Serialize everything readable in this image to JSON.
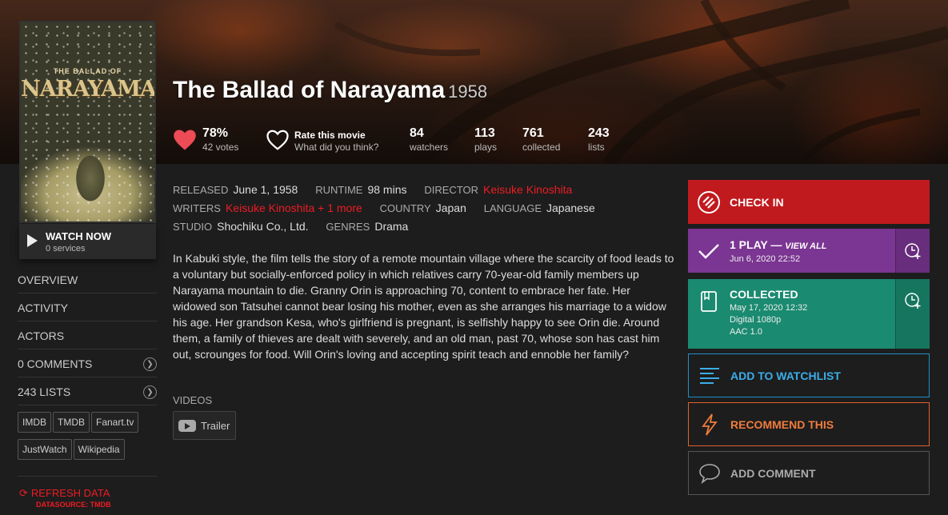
{
  "movie": {
    "title": "The Ballad of Narayama",
    "year": "1958",
    "poster_small": "THE BALLAD OF",
    "poster_big": "NARAYAMA"
  },
  "watch_now": {
    "label": "WATCH NOW",
    "sub": "0 services"
  },
  "nav": [
    {
      "label": "OVERVIEW"
    },
    {
      "label": "ACTIVITY"
    },
    {
      "label": "ACTORS"
    },
    {
      "label": "0 COMMENTS"
    },
    {
      "label": "243 LISTS"
    }
  ],
  "external_links": [
    "IMDB",
    "TMDB",
    "Fanart.tv",
    "JustWatch",
    "Wikipedia"
  ],
  "refresh": {
    "label": "REFRESH DATA",
    "source": "DATASOURCE: TMDB"
  },
  "stats": {
    "rating": {
      "value": "78%",
      "label": "42 votes"
    },
    "rate": {
      "value": "Rate this movie",
      "label": "What did you think?"
    },
    "watchers": {
      "value": "84",
      "label": "watchers"
    },
    "plays": {
      "value": "113",
      "label": "plays"
    },
    "collected": {
      "value": "761",
      "label": "collected"
    },
    "lists": {
      "value": "243",
      "label": "lists"
    }
  },
  "meta": {
    "released_k": "RELEASED",
    "released": "June 1, 1958",
    "runtime_k": "RUNTIME",
    "runtime": "98 mins",
    "director_k": "DIRECTOR",
    "director": "Keisuke Kinoshita",
    "writers_k": "WRITERS",
    "writers": "Keisuke Kinoshita + 1 more",
    "country_k": "COUNTRY",
    "country": "Japan",
    "language_k": "LANGUAGE",
    "language": "Japanese",
    "studio_k": "STUDIO",
    "studio": "Shochiku Co., Ltd.",
    "genres_k": "GENRES",
    "genres": "Drama"
  },
  "overview": "In Kabuki style, the film tells the story of a remote mountain village where the scarcity of food leads to a voluntary but socially-enforced policy in which relatives carry 70-year-old family members up Narayama mountain to die. Granny Orin is approaching 70, content to embrace her fate. Her widowed son Tatsuhei cannot bear losing his mother, even as she arranges his marriage to a widow his age. Her grandson Kesa, who's girlfriend is pregnant, is selfishly happy to see Orin die. Around them, a family of thieves are dealt with severely, and an old man, past 70, whose son has cast him out, scrounges for food. Will Orin's loving and accepting spirit teach and ennoble her family?",
  "videos": {
    "heading": "VIDEOS",
    "trailer": "Trailer"
  },
  "actions": {
    "checkin": "CHECK IN",
    "plays_title": "1 PLAY —",
    "plays_view_all": "VIEW ALL",
    "plays_date": "Jun 6, 2020 22:52",
    "collected_title": "COLLECTED",
    "collected_date": "May 17, 2020 12:32",
    "collected_format": "Digital 1080p",
    "collected_audio": "AAC 1.0",
    "watchlist": "ADD TO WATCHLIST",
    "recommend": "RECOMMEND THIS",
    "comment": "ADD COMMENT"
  },
  "colors": {
    "accent": "#ed1c24",
    "checkin": "#c11a1e",
    "plays": "#7b3592",
    "collected": "#1a8a70",
    "watchlist": "#1f8fc7",
    "recommend": "#e0612a"
  }
}
